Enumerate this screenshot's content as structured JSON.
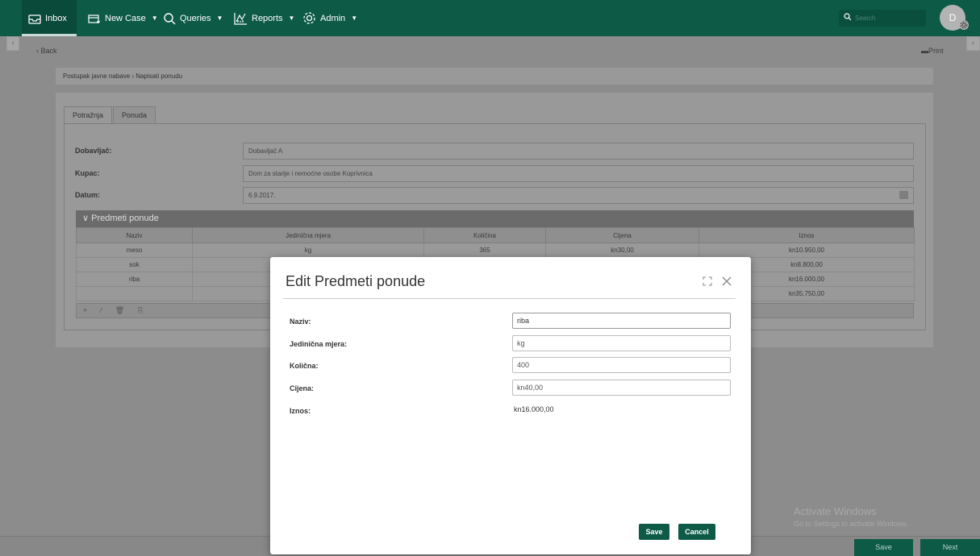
{
  "nav": {
    "inbox": "Inbox",
    "new_case": "New Case",
    "queries": "Queries",
    "reports": "Reports",
    "admin": "Admin",
    "search_placeholder": "Search",
    "avatar_initial": "D"
  },
  "page": {
    "back": "Back",
    "print": "Print",
    "breadcrumb": "Postupak javne nabave › Napisati ponudu",
    "tabs": [
      "Potražnja",
      "Ponuda"
    ]
  },
  "form": {
    "dobavljac_label": "Dobavljač:",
    "dobavljac_value": "Dobavljač A",
    "kupac_label": "Kupac:",
    "kupac_value": "Dom za starije i nemoćne osobe Koprivnica",
    "datum_label": "Datum:",
    "datum_value": "6.9.2017."
  },
  "grid": {
    "title": "Predmeti ponude",
    "columns": [
      "Naziv",
      "Jedinična mjera",
      "Količina",
      "Cijena",
      "Iznos"
    ],
    "rows": [
      [
        "meso",
        "kg",
        "365",
        "kn30,00",
        "kn10.950,00"
      ],
      [
        "sok",
        "",
        "",
        "",
        "kn8.800,00"
      ],
      [
        "riba",
        "",
        "",
        "",
        "kn16.000,00"
      ],
      [
        "",
        "",
        "",
        "",
        "kn35.750,00"
      ]
    ],
    "toolbar": "+ ⁄ 🗑 ⎘"
  },
  "footer": {
    "save": "Save",
    "next": "Next",
    "activate_title": "Activate Windows",
    "activate_sub": "Go to Settings to activate Windows."
  },
  "modal": {
    "title": "Edit Predmeti ponude",
    "naziv_label": "Naziv:",
    "naziv_value": "riba",
    "mjera_label": "Jedinična mjera:",
    "mjera_value": "kg",
    "kolicina_label": "Količna:",
    "kolicina_value": "400",
    "cijena_label": "Cijena:",
    "cijena_value": "kn40,00",
    "iznos_label": "Iznos:",
    "iznos_value": "kn16.000,00",
    "save": "Save",
    "cancel": "Cancel"
  },
  "colors": {
    "brand": "#0d5a47",
    "overlay": "#8c8c8c"
  }
}
